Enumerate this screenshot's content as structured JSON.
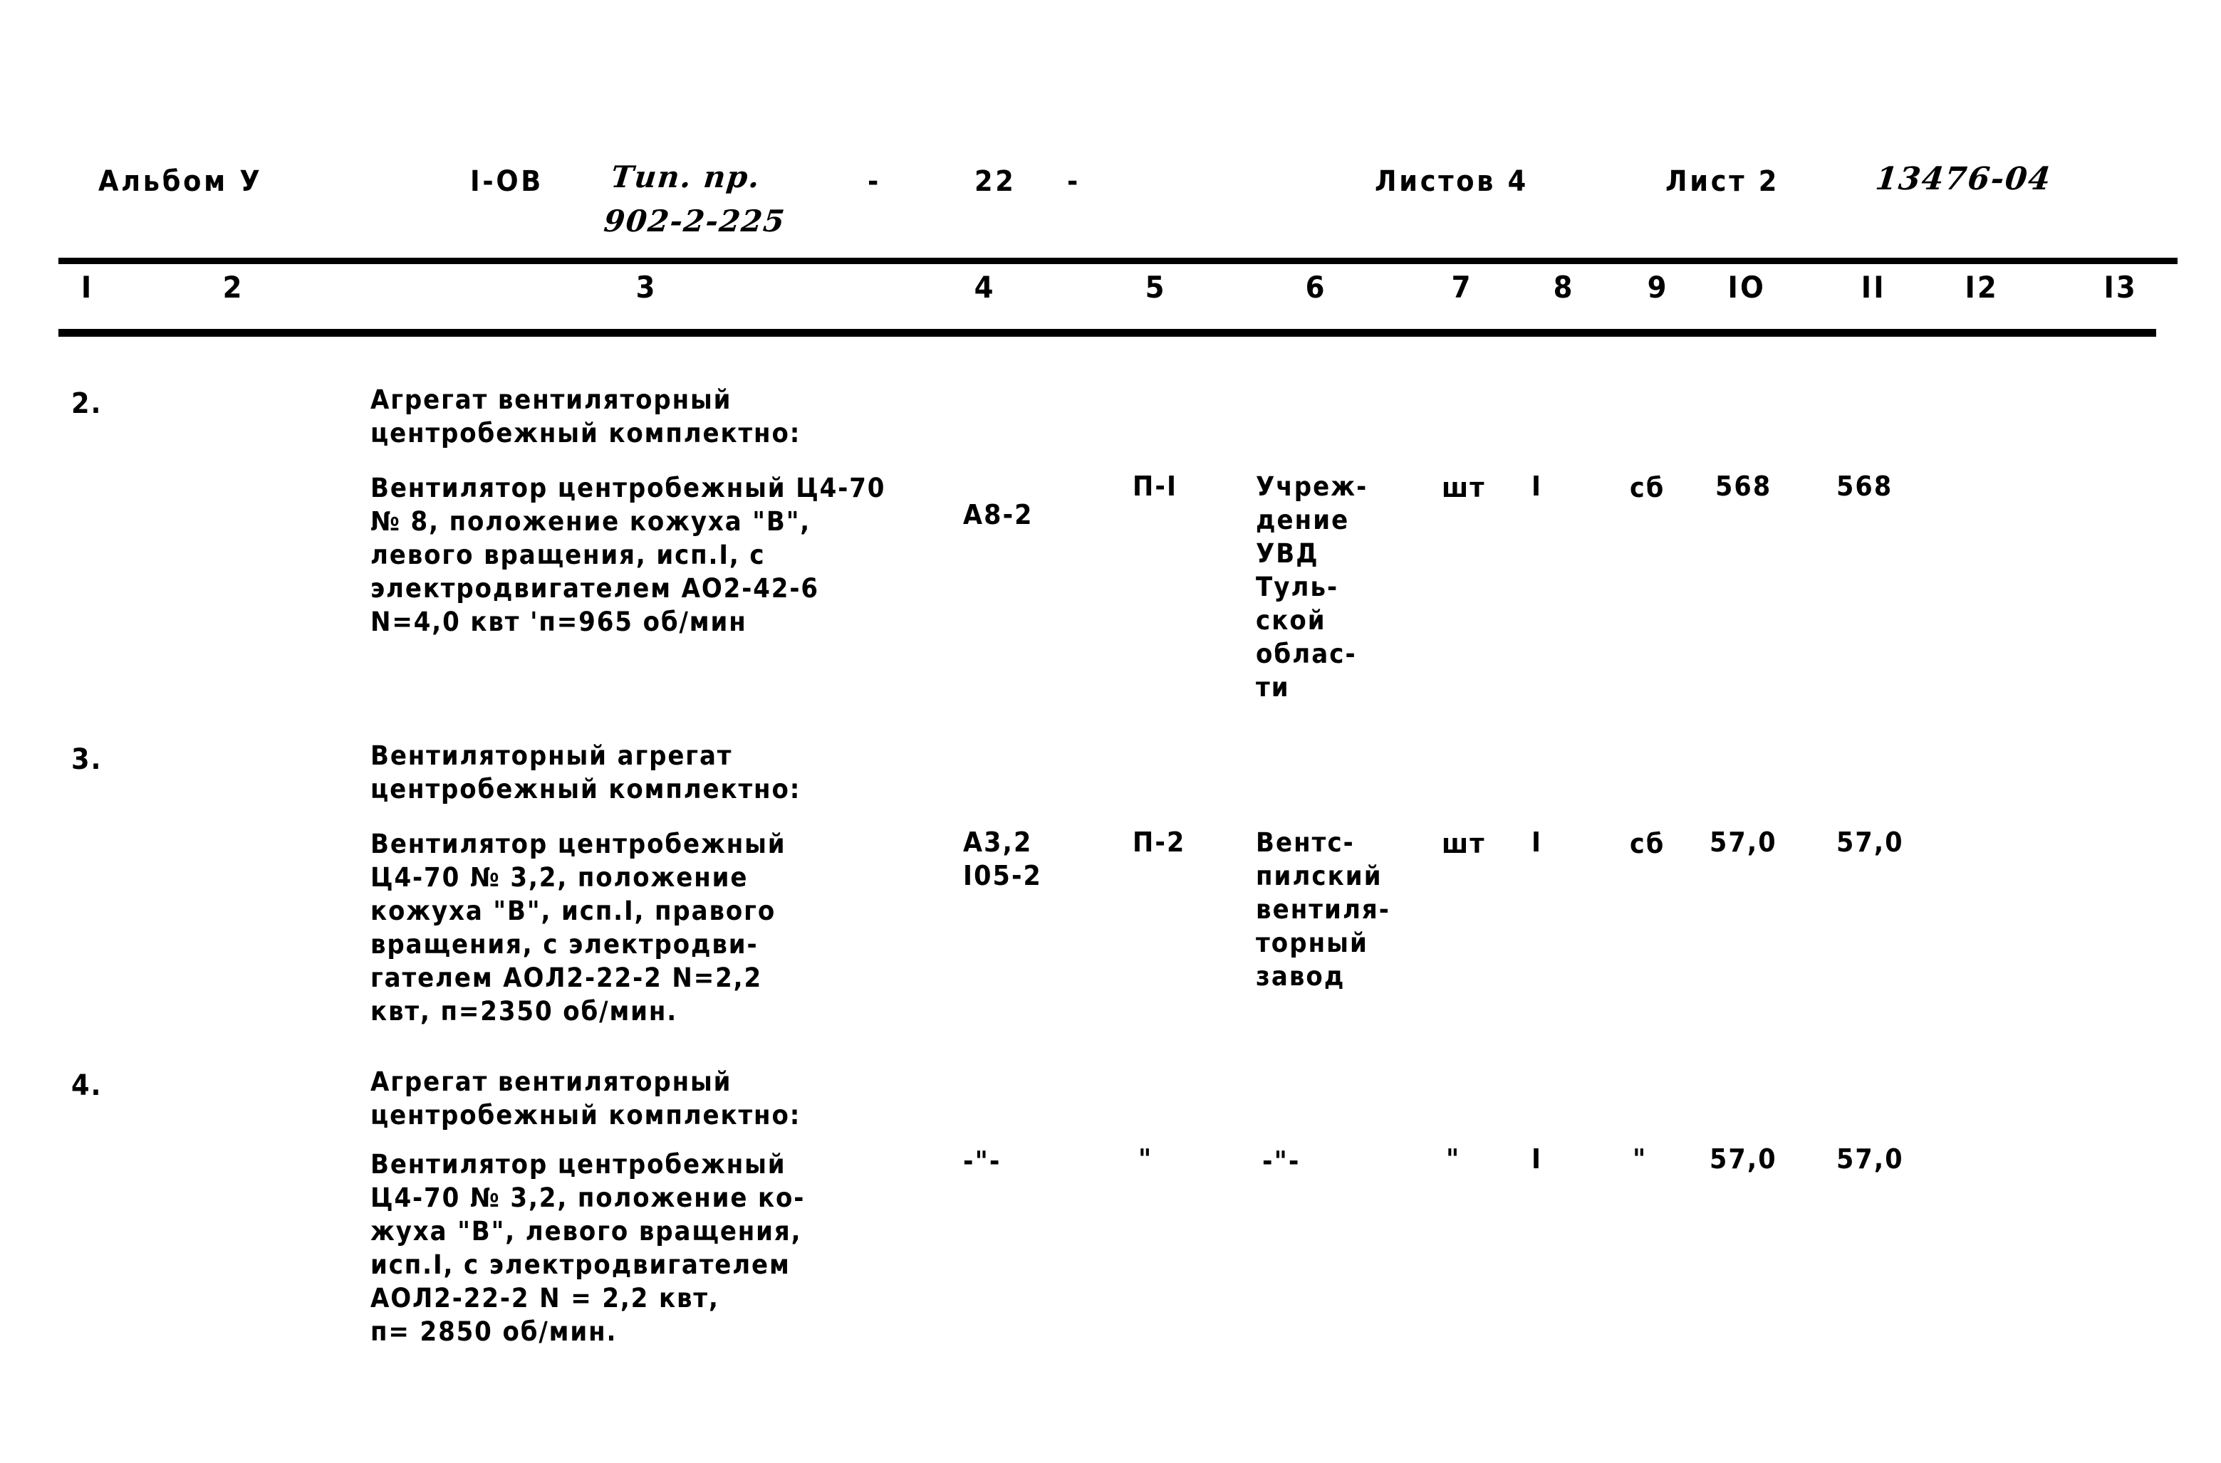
{
  "document": {
    "kind": "scanned-specification-sheet",
    "header": {
      "album_label": "Альбом У",
      "section_code": "I-ОВ",
      "typical_project_label": "Тип. пр.",
      "typical_project_number": "902-2-225",
      "dash_left": "-",
      "page_marker": "22",
      "dash_right": "-",
      "sheets_total_label": "Листов 4",
      "sheet_label": "Лист 2",
      "drawing_number": "13476-04"
    },
    "column_numbers": [
      "I",
      "2",
      "3",
      "4",
      "5",
      "6",
      "7",
      "8",
      "9",
      "IO",
      "II",
      "I2",
      "I3"
    ],
    "rows": [
      {
        "no": "2.",
        "title": "Агрегат вентиляторный\nцентробежный комплектно:",
        "description": "Вентилятор центробежный Ц4-70\n№ 8, положение кожуха \"В\",\nлевого вращения, исп.I, с\nэлектродвигателем АО2-42-6\nN=4,0 квт 'п=965 об/мин",
        "col4": "А8-2",
        "col5": "П-I",
        "col6": "Учреж-\nдение\nУВД\nТуль-\nской\nоблас-\nти",
        "col7": "шт",
        "col8": "I",
        "col9": "сб",
        "col10": "568",
        "col11": "568",
        "col12": "",
        "col13": ""
      },
      {
        "no": "3.",
        "title": "Вентиляторный агрегат\nцентробежный комплектно:",
        "description": "Вентилятор центробежный\nЦ4-70 № 3,2, положение\nкожуха \"В\", исп.I, правого\nвращения, с электродви-\nгателем АОЛ2-22-2 N=2,2\nквт, п=2350 об/мин.",
        "col4": "А3,2\nI05-2",
        "col5": "П-2",
        "col6": "Вентс-\nпилский\nвентиля-\nторный\nзавод",
        "col7": "шт",
        "col8": "I",
        "col9": "сб",
        "col10": "57,0",
        "col11": "57,0",
        "col12": "",
        "col13": ""
      },
      {
        "no": "4.",
        "title": "Агрегат вентиляторный\nцентробежный комплектно:",
        "description": "Вентилятор центробежный\nЦ4-70 № 3,2, положение ко-\nжуха \"В\", левого вращения,\nисп.I, с электродвигателем\nАОЛ2-22-2 N = 2,2 квт,\nп= 2850 об/мин.",
        "col4": "-\"-",
        "col5": "\"",
        "col6": "-\"-",
        "col7": "\"",
        "col8": "I",
        "col9": "\"",
        "col10": "57,0",
        "col11": "57,0",
        "col12": "",
        "col13": ""
      }
    ]
  }
}
